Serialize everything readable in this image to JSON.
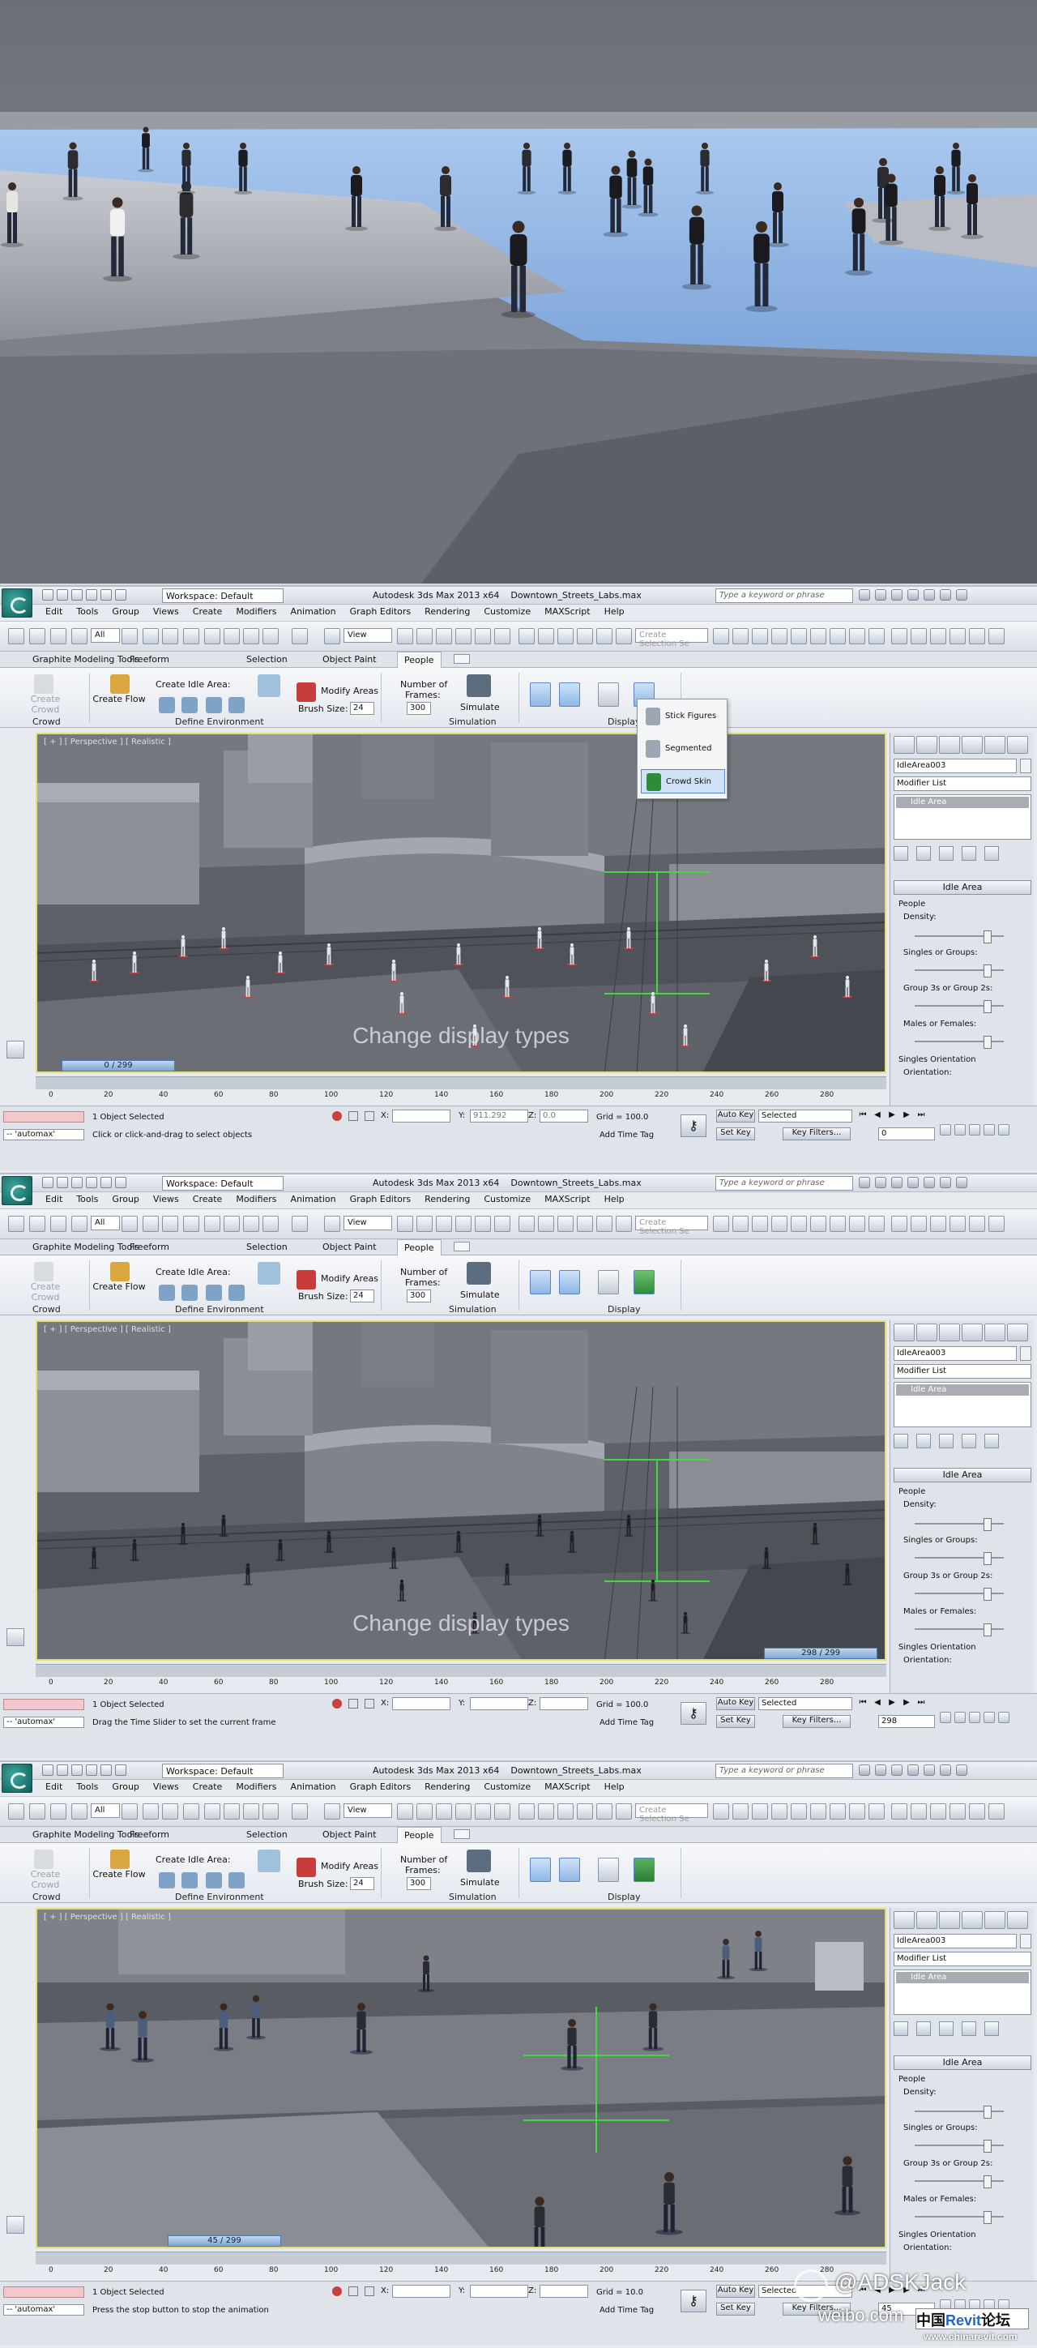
{
  "app": {
    "workspace": "Workspace: Default",
    "title": "Autodesk 3ds Max 2013 x64",
    "file": "Downtown_Streets_Labs.max",
    "search_placeholder": "Type a keyword or phrase"
  },
  "menu": [
    "Edit",
    "Tools",
    "Group",
    "Views",
    "Create",
    "Modifiers",
    "Animation",
    "Graph Editors",
    "Rendering",
    "Customize",
    "MAXScript",
    "Help"
  ],
  "toolbar": {
    "filter": "All",
    "ref_coord": "View",
    "selection_set": "Create Selection Se"
  },
  "tabs": [
    "Graphite Modeling Tools",
    "Freeform",
    "Selection",
    "Object Paint",
    "People"
  ],
  "ribbon": {
    "create_crowd": "Create Crowd",
    "create_flow": "Create Flow",
    "create_idle_area": "Create Idle Area:",
    "modify_areas": "Modify Areas",
    "brush_size_label": "Brush Size:",
    "brush_size": "24",
    "frames_label_1": "Number of",
    "frames_label_2": "Frames:",
    "frames": "300",
    "simulate": "Simulate",
    "groups": {
      "crowd": "Crowd",
      "define_env": "Define Environment",
      "simulation": "Simulation",
      "display": "Display"
    }
  },
  "flyout": [
    "Stick Figures",
    "Segmented",
    "Crowd Skin"
  ],
  "command_panel": {
    "object_name": "IdleArea003",
    "modifier_list": "Modifier List",
    "stack_item": "Idle Area",
    "rollout": "Idle Area",
    "people": "People",
    "density": "Density:",
    "singles_groups": "Singles or Groups:",
    "group_3s": "Group 3s or Group 2s:",
    "males_females": "Males or Females:",
    "singles_orientation": "Singles Orientation",
    "orientation": "Orientation:"
  },
  "ticks": [
    "0",
    "20",
    "40",
    "60",
    "80",
    "100",
    "120",
    "140",
    "160",
    "180",
    "200",
    "220",
    "240",
    "260",
    "280"
  ],
  "overlay_caption": "Change display types",
  "status": {
    "maxscript": "-- 'automax'",
    "selected": "1 Object Selected",
    "x_label": "X:",
    "y_label": "Y:",
    "z_label": "Z:",
    "add_time_tag": "Add Time Tag",
    "auto_key": "Auto Key",
    "set_key": "Set Key",
    "selected_dd": "Selected",
    "key_filters": "Key Filters..."
  },
  "panels": [
    {
      "viewport_label": "[ + ] [ Perspective ] [ Realistic ]",
      "slider": "0 / 299",
      "slider_pos": 0,
      "prompt": "Click or click-and-drag to select objects",
      "y_value": "911.292",
      "z_value": "0.0",
      "grid": "Grid = 100.0",
      "frame": "0",
      "show_flyout": true,
      "display_mode": "stick"
    },
    {
      "viewport_label": "[ + ] [ Perspective ] [ Realistic ]",
      "slider": "298 / 299",
      "slider_pos": 0.9967,
      "prompt": "Drag the Time Slider to set the current frame",
      "y_value": "",
      "z_value": "",
      "grid": "Grid = 100.0",
      "frame": "298",
      "show_flyout": false,
      "display_mode": "segmented"
    },
    {
      "viewport_label": "[ + ] [ Perspective ] [ Realistic ]",
      "slider": "45 / 299",
      "slider_pos": 0.1505,
      "prompt": "Press the stop button to stop the animation",
      "y_value": "",
      "z_value": "",
      "grid": "Grid = 10.0",
      "frame": "45",
      "show_flyout": false,
      "display_mode": "skin"
    }
  ],
  "watermark": {
    "handle": "@ADSKJack",
    "site": "weibo.com",
    "brand_cn": "中国",
    "brand": "Revit",
    "brand_cn2": "论坛",
    "url": "www.chinarevit.com"
  },
  "colors": {
    "viewport_border": "#e2e26a",
    "floor_blue": "#8fb6e8",
    "slider_blue": "#7fa5d4"
  }
}
